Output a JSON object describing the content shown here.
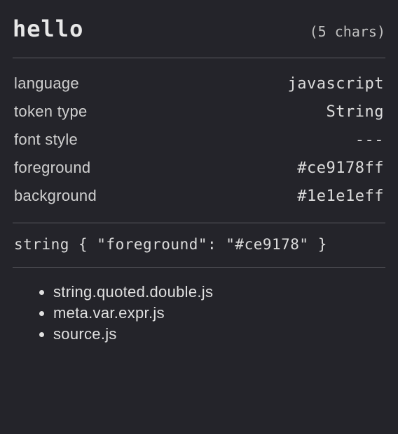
{
  "header": {
    "token_text": "hello",
    "char_count": "(5 chars)"
  },
  "props": {
    "language": {
      "label": "language",
      "value": "javascript"
    },
    "token_type": {
      "label": "token type",
      "value": "String"
    },
    "font_style": {
      "label": "font style",
      "value": "---"
    },
    "foreground": {
      "label": "foreground",
      "value": "#ce9178ff"
    },
    "background": {
      "label": "background",
      "value": "#1e1e1eff"
    }
  },
  "rule": "string { \"foreground\": \"#ce9178\" }",
  "scopes": [
    "string.quoted.double.js",
    "meta.var.expr.js",
    "source.js"
  ]
}
